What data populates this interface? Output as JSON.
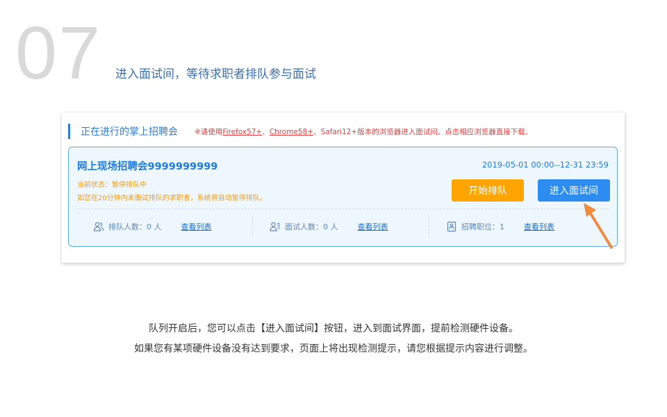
{
  "step": {
    "number": "07",
    "title": "进入面试间，等待求职者排队参与面试"
  },
  "panel": {
    "header_title": "正在进行的掌上招聘会",
    "notice": {
      "prefix": "※请使用",
      "firefox": "Firefox57+",
      "sep1": "、",
      "chrome": "Chrome58+",
      "rest": "、Safari12+版本的浏览器进入面试间。点击相应浏览器直接下载。"
    }
  },
  "card": {
    "name": "网上现场招聘会9999999999",
    "date_range": "2019-05-01 00:00--12-31 23:59",
    "status": "当前状态：暂停排队中",
    "warning": "如您在20分钟内未面试排队的求职者，系统将自动暂停排队。",
    "buttons": {
      "start_queue": "开始排队",
      "enter_room": "进入面试间"
    },
    "stats": [
      {
        "label": "排队人数：0 人",
        "link": "查看列表",
        "icon": "people-icon"
      },
      {
        "label": "面试人数：0 人",
        "link": "查看列表",
        "icon": "person-list-icon"
      },
      {
        "label": "招聘职位：1",
        "link": "查看列表",
        "icon": "document-icon"
      }
    ]
  },
  "captions": [
    "队列开启后，您可以点击【进入面试间】按钮，进入到面试界面，提前检测硬件设备。",
    "如果您有某项硬件设备没有达到要求，页面上将出现检测提示，请您根据提示内容进行调整。"
  ],
  "colors": {
    "accent_blue": "#2d8cf0",
    "orange": "#ffa502",
    "notice_red": "#e23b3b",
    "arrow": "#f28a3c"
  }
}
